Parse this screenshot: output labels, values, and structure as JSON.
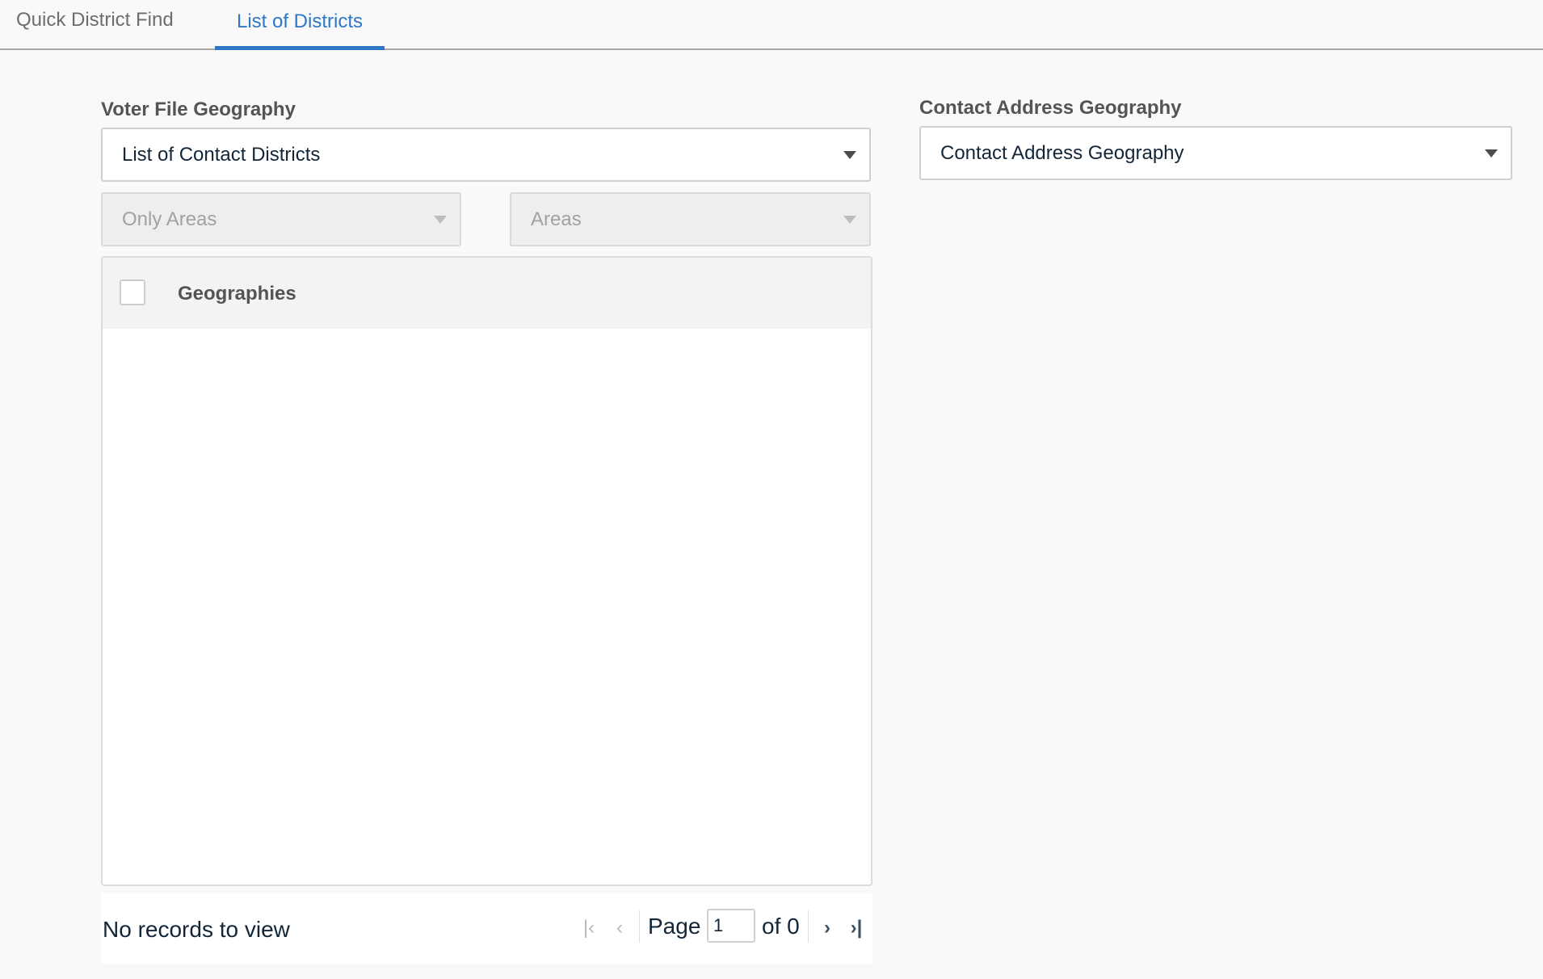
{
  "tabs": {
    "quick_district_find": "Quick District Find",
    "list_of_districts": "List of Districts"
  },
  "voter_file": {
    "label": "Voter File Geography",
    "select_value": "List of Contact Districts",
    "filter_only_areas": "Only Areas",
    "filter_areas": "Areas"
  },
  "contact_address": {
    "label": "Contact Address Geography",
    "select_value": "Contact Address Geography"
  },
  "grid": {
    "column_header": "Geographies"
  },
  "pager": {
    "no_records": "No records to view",
    "page_label": "Page",
    "page_value": "1",
    "of_label": "of 0",
    "first_icon": "first-page-icon",
    "prev_icon": "previous-page-icon",
    "next_icon": "next-page-icon",
    "last_icon": "last-page-icon"
  },
  "colors": {
    "accent": "#2e77c6",
    "text_dark": "#132638",
    "label_gray": "#545454"
  }
}
